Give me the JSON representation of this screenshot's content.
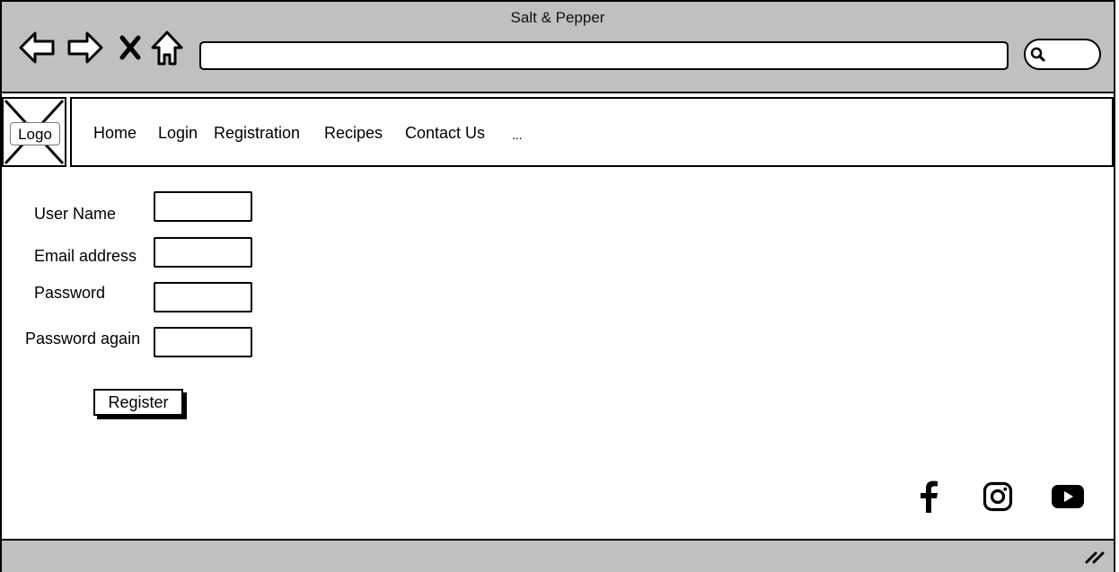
{
  "window": {
    "title": "Salt & Pepper",
    "address_value": "",
    "search_value": ""
  },
  "header": {
    "logo_label": "Logo",
    "menu": [
      "Home",
      "Login",
      "Registration",
      "Recipes",
      "Contact Us",
      "..."
    ]
  },
  "form": {
    "username_label": "User Name",
    "email_label": "Email address",
    "password_label": "Password",
    "password_again_label": "Password again",
    "username_value": "",
    "email_value": "",
    "password_value": "",
    "password_again_value": "",
    "register_label": "Register"
  },
  "social": {
    "icons": [
      "facebook-icon",
      "instagram-icon",
      "youtube-icon"
    ]
  },
  "colors": {
    "chrome": "#c0c0c0",
    "border": "#000000",
    "background": "#ffffff"
  }
}
